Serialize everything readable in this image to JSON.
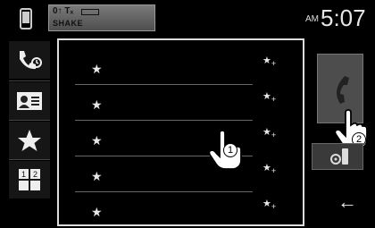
{
  "status": {
    "signal": "0↑ Tₓ",
    "carrier": "SHAKE",
    "ampm": "AM",
    "time": "5:07"
  },
  "sidebar": {
    "items": [
      {
        "icon": "phone-call-icon"
      },
      {
        "icon": "contact-card-icon"
      },
      {
        "icon": "star-icon"
      },
      {
        "icon": "dial-pad-icon"
      }
    ]
  },
  "list": {
    "rows": [
      {
        "star": "★",
        "preset": "★"
      },
      {
        "star": "★",
        "preset": "★"
      },
      {
        "star": "★",
        "preset": "★"
      },
      {
        "star": "★",
        "preset": "★"
      },
      {
        "star": "★",
        "preset": "★"
      }
    ]
  },
  "callouts": {
    "one": "1",
    "two": "2"
  },
  "colors": {
    "background": "#000000",
    "panel_border": "#dddddd",
    "button": "#4d4d4d"
  }
}
